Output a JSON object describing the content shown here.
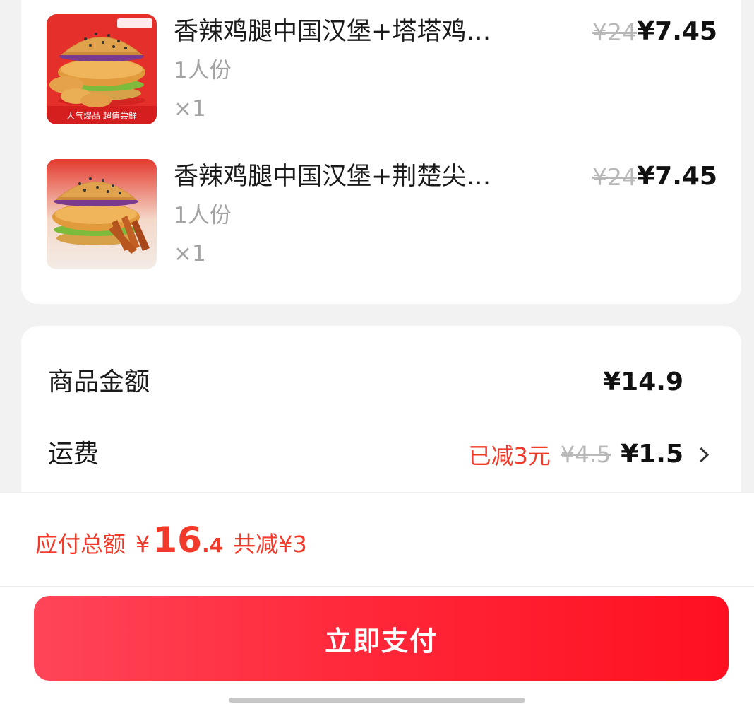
{
  "items": [
    {
      "name": "香辣鸡腿中国汉堡+塔塔鸡…",
      "spec": "1人份",
      "qty": "×1",
      "original_price": "¥24",
      "price": "¥7.45",
      "badge": "人气爆品  超值尝鲜"
    },
    {
      "name": "香辣鸡腿中国汉堡+荆楚尖…",
      "spec": "1人份",
      "qty": "×1",
      "original_price": "¥24",
      "price": "¥7.45"
    }
  ],
  "fees": {
    "subtotal_label": "商品金额",
    "subtotal_value": "¥14.9",
    "shipping_label": "运费",
    "shipping_discount": "已减3元",
    "shipping_original": "¥4.5",
    "shipping_value": "¥1.5"
  },
  "footer": {
    "total_label": "应付总额",
    "total_yen": "¥",
    "total_int": "16",
    "total_dec": ".4",
    "total_saved": "共减¥3",
    "pay_label": "立即支付"
  },
  "colors": {
    "accent": "#f23a2b",
    "pay_button": "#ff2638",
    "background": "#f2f2f2"
  }
}
